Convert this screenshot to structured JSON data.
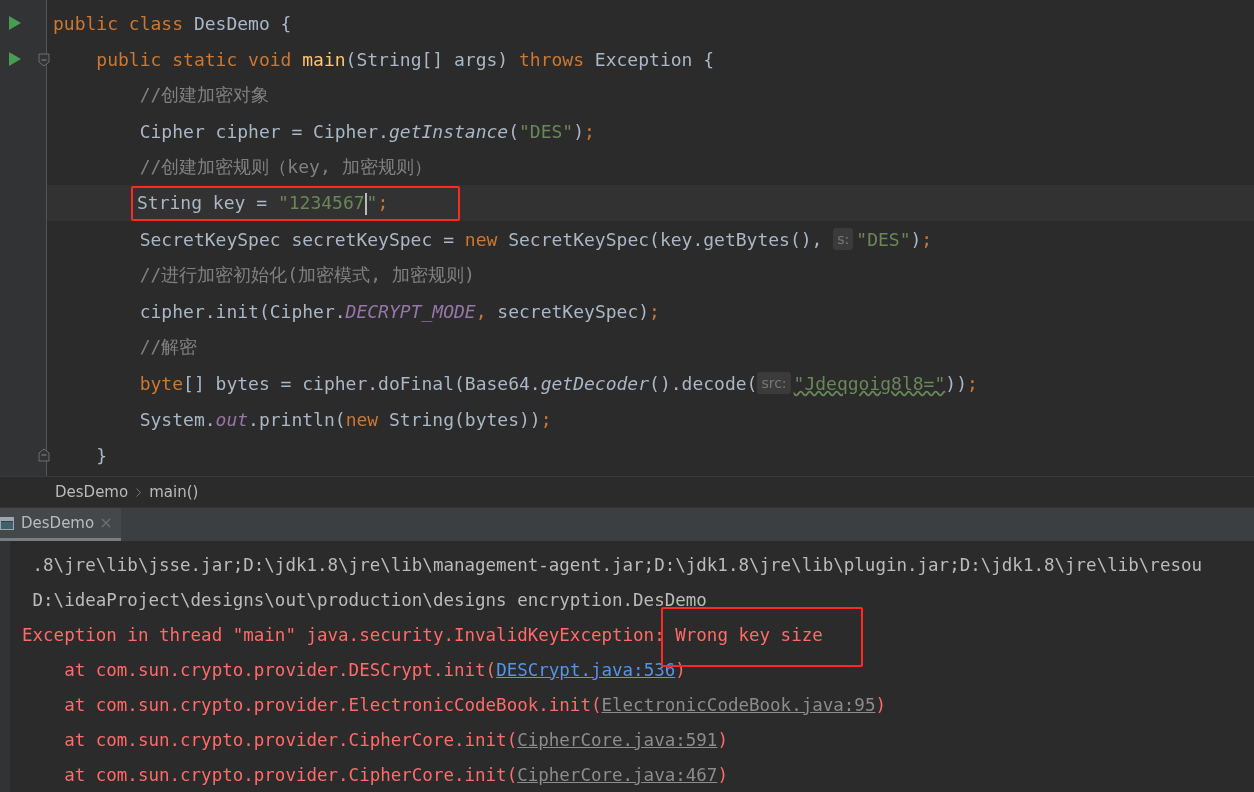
{
  "editor": {
    "lines": [
      {
        "run": true,
        "tokens": [
          {
            "t": "public class ",
            "kind": "kw"
          },
          {
            "t": "DesDemo {",
            "kind": "plain"
          }
        ]
      },
      {
        "run": true,
        "fold_start": true,
        "tokens": [
          {
            "t": "    public static void ",
            "kind": "kw"
          },
          {
            "t": "main",
            "kind": "decl"
          },
          {
            "t": "(String[] args) ",
            "kind": "plain"
          },
          {
            "t": "throws ",
            "kind": "kw"
          },
          {
            "t": "Exception {",
            "kind": "plain"
          }
        ]
      },
      {
        "tokens": [
          {
            "t": "        //创建加密对象",
            "kind": "comment"
          }
        ]
      },
      {
        "tokens": [
          {
            "t": "        Cipher cipher = Cipher.",
            "kind": "plain"
          },
          {
            "t": "getInstance",
            "kind": "italic"
          },
          {
            "t": "(",
            "kind": "plain"
          },
          {
            "t": "\"DES\"",
            "kind": "str"
          },
          {
            "t": ")",
            "kind": "plain"
          },
          {
            "t": ";",
            "kind": "kw"
          }
        ]
      },
      {
        "tokens": [
          {
            "t": "        //创建加密规则（key, 加密规则）",
            "kind": "comment"
          }
        ]
      },
      {
        "current": true,
        "boxed": true,
        "tokens": [
          {
            "t": "        String key = ",
            "kind": "plain"
          },
          {
            "t": "\"1234567",
            "kind": "str",
            "cursor": true
          },
          {
            "t": "\"",
            "kind": "str"
          },
          {
            "t": ";",
            "kind": "kw"
          }
        ]
      },
      {
        "tokens": [
          {
            "t": "        SecretKeySpec secretKeySpec = ",
            "kind": "plain"
          },
          {
            "t": "new ",
            "kind": "kw"
          },
          {
            "t": "SecretKeySpec(key.getBytes(), ",
            "kind": "plain"
          },
          {
            "t": "s:",
            "kind": "hint"
          },
          {
            "t": "\"DES\"",
            "kind": "str"
          },
          {
            "t": ")",
            "kind": "plain"
          },
          {
            "t": ";",
            "kind": "kw"
          }
        ]
      },
      {
        "tokens": [
          {
            "t": "        //进行加密初始化(加密模式, 加密规则)",
            "kind": "comment"
          }
        ]
      },
      {
        "tokens": [
          {
            "t": "        cipher.init(Cipher.",
            "kind": "plain"
          },
          {
            "t": "DECRYPT_MODE",
            "kind": "static"
          },
          {
            "t": ", ",
            "kind": "kw"
          },
          {
            "t": "secretKeySpec)",
            "kind": "plain"
          },
          {
            "t": ";",
            "kind": "kw"
          }
        ]
      },
      {
        "tokens": [
          {
            "t": "        //解密",
            "kind": "comment"
          }
        ]
      },
      {
        "tokens": [
          {
            "t": "        byte",
            "kind": "kw"
          },
          {
            "t": "[] bytes = cipher.doFinal(Base64.",
            "kind": "plain"
          },
          {
            "t": "getDecoder",
            "kind": "italic"
          },
          {
            "t": "().decode(",
            "kind": "plain"
          },
          {
            "t": "src:",
            "kind": "hint"
          },
          {
            "t": "\"Jdeqgoig8l8=\"",
            "kind": "str",
            "typo": true
          },
          {
            "t": "))",
            "kind": "plain"
          },
          {
            "t": ";",
            "kind": "kw"
          }
        ]
      },
      {
        "tokens": [
          {
            "t": "        System.",
            "kind": "plain"
          },
          {
            "t": "out",
            "kind": "static"
          },
          {
            "t": ".println(",
            "kind": "plain"
          },
          {
            "t": "new ",
            "kind": "kw"
          },
          {
            "t": "String(bytes))",
            "kind": "plain"
          },
          {
            "t": ";",
            "kind": "kw"
          }
        ]
      },
      {
        "fold_end": true,
        "tokens": [
          {
            "t": "    }",
            "kind": "plain"
          }
        ]
      }
    ]
  },
  "breadcrumbs": [
    "DesDemo",
    "main()"
  ],
  "run_tabs": [
    {
      "title": "DesDemo",
      "selected": true
    }
  ],
  "console": {
    "lines": [
      {
        "segments": [
          {
            "t": " .8\\jre\\lib\\jsse.jar;D:\\jdk1.8\\jre\\lib\\management-agent.jar;D:\\jdk1.8\\jre\\lib\\plugin.jar;D:\\jdk1.8\\jre\\lib\\resou",
            "kind": "output"
          }
        ]
      },
      {
        "segments": [
          {
            "t": " D:\\ideaProject\\designs\\out\\production\\designs encryption.DesDemo",
            "kind": "output"
          }
        ]
      },
      {
        "segments": [
          {
            "t": "Exception in thread \"main\" java.security.InvalidKeyException: ",
            "kind": "error"
          },
          {
            "t": "Wrong key size",
            "kind": "error",
            "boxed": true
          }
        ]
      },
      {
        "segments": [
          {
            "t": "    at com.sun.crypto.provider.DESCrypt.init(",
            "kind": "error"
          },
          {
            "t": "DESCrypt.java:536",
            "kind": "link"
          },
          {
            "t": ")",
            "kind": "error"
          }
        ]
      },
      {
        "segments": [
          {
            "t": "    at com.sun.crypto.provider.ElectronicCodeBook.init(",
            "kind": "error"
          },
          {
            "t": "ElectronicCodeBook.java:95",
            "kind": "file"
          },
          {
            "t": ")",
            "kind": "error"
          }
        ]
      },
      {
        "segments": [
          {
            "t": "    at com.sun.crypto.provider.CipherCore.init(",
            "kind": "error"
          },
          {
            "t": "CipherCore.java:591",
            "kind": "file"
          },
          {
            "t": ")",
            "kind": "error"
          }
        ]
      },
      {
        "segments": [
          {
            "t": "    at com.sun.crypto.provider.CipherCore.init(",
            "kind": "error"
          },
          {
            "t": "CipherCore.java:467",
            "kind": "file"
          },
          {
            "t": ")",
            "kind": "error"
          }
        ]
      }
    ]
  }
}
